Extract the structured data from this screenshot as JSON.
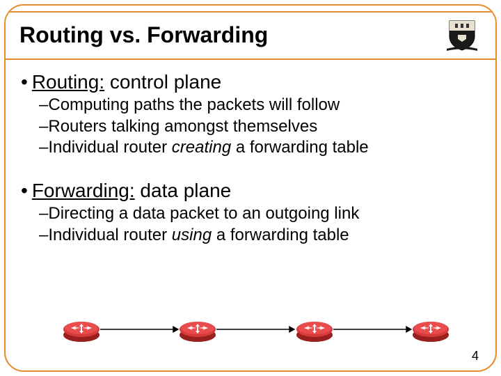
{
  "slide": {
    "title": "Routing vs. Forwarding",
    "page_number": "4"
  },
  "section1": {
    "head_prefix": "Routing:",
    "head_rest": " control plane",
    "bul1_a": "Computing paths the packets will follow",
    "bul1_b": "Routers talking amongst themselves",
    "bul1_c_pre": "Individual router ",
    "bul1_c_em": "creating",
    "bul1_c_post": " a forwarding table"
  },
  "section2": {
    "head_prefix": "Forwarding:",
    "head_rest": " data plane",
    "bul2_a": "Directing a data packet to an outgoing link",
    "bul2_b_pre": "Individual router ",
    "bul2_b_em": "using",
    "bul2_b_post": " a forwarding table"
  },
  "icons": {
    "crest": "princeton-shield-icon",
    "router": "router-icon",
    "arrow": "arrow-right-icon"
  }
}
